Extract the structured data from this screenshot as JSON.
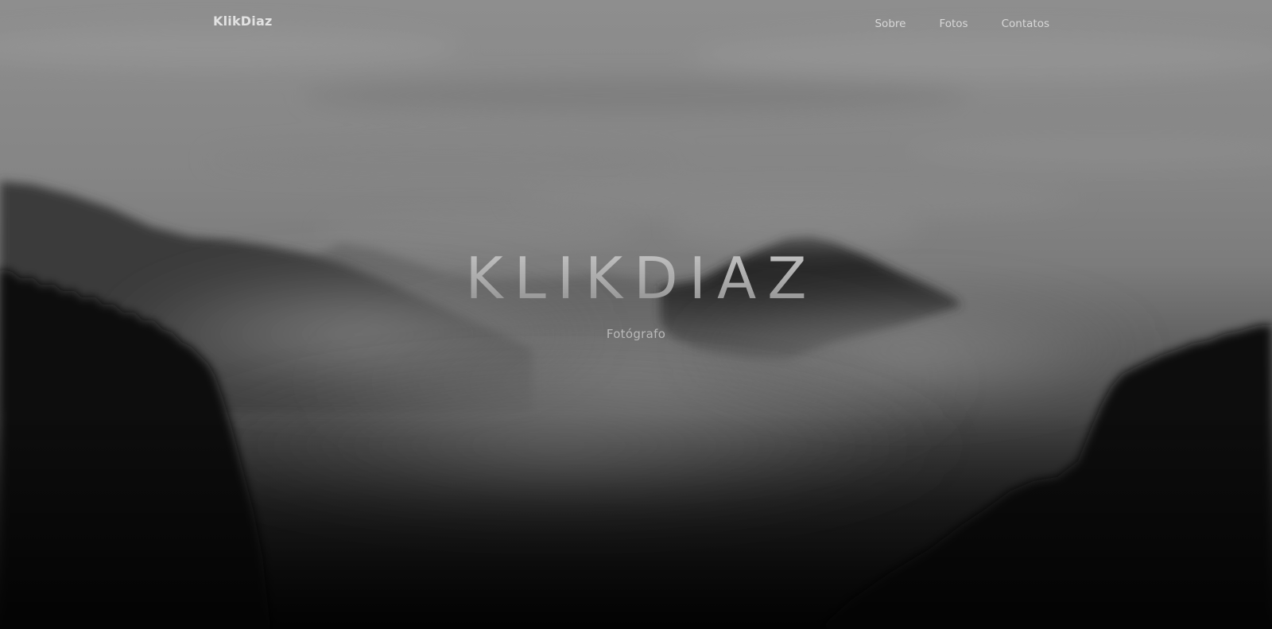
{
  "header": {
    "brand": "KlikDiaz",
    "nav": [
      {
        "label": "Sobre"
      },
      {
        "label": "Fotos"
      },
      {
        "label": "Contatos"
      }
    ]
  },
  "hero": {
    "title": "KLIKDIAZ",
    "subtitle": "Fotógrafo",
    "background": "foggy-mountain-forest-photo"
  },
  "colors": {
    "text_light": "#e2e2e2",
    "title_gray": "#b0b0b0",
    "subtitle_gray": "#b9b9b9",
    "sky_gray": "#8a8a8a",
    "forest_dark": "#0c0c0c"
  }
}
